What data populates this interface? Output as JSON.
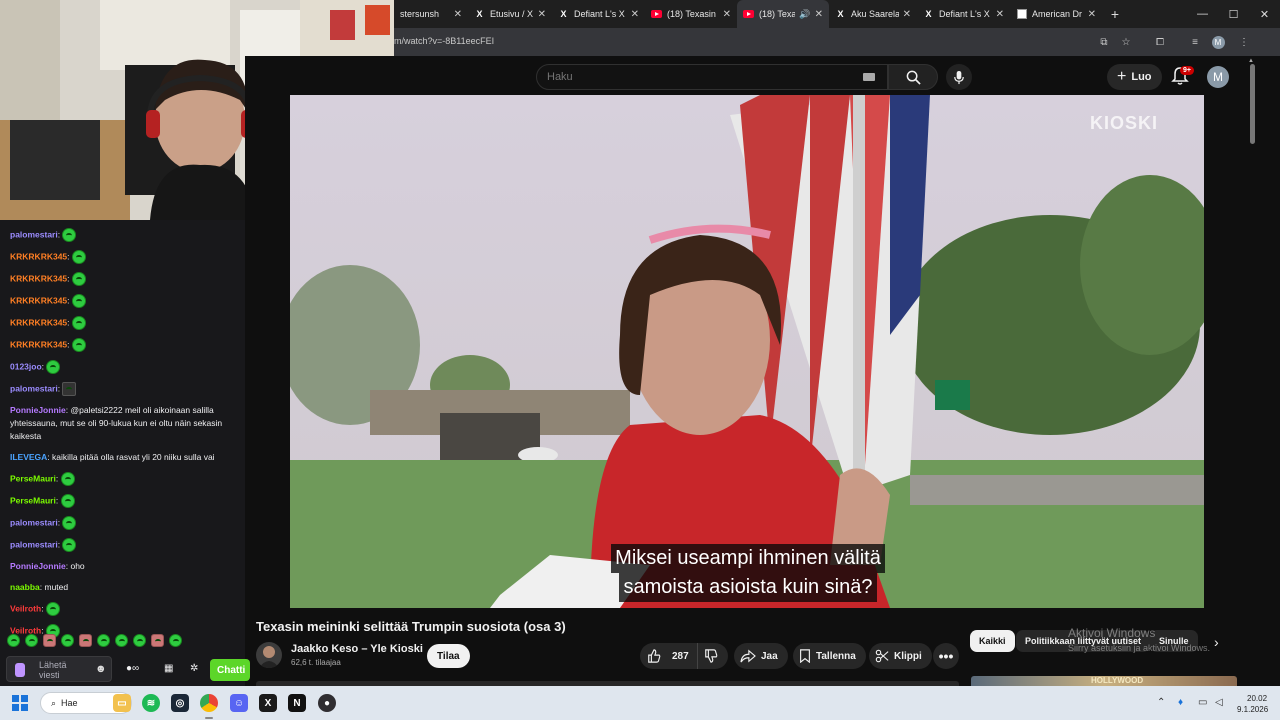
{
  "browser": {
    "tabs": [
      {
        "label": "stersunsh",
        "icon": "none",
        "active": false
      },
      {
        "label": "Etusivu / X",
        "icon": "x",
        "active": false
      },
      {
        "label": "Defiant L's X",
        "icon": "x",
        "active": false
      },
      {
        "label": "(18) Texasin",
        "icon": "youtube",
        "active": false
      },
      {
        "label": "(18) Texa",
        "icon": "youtube",
        "active": true
      },
      {
        "label": "Aku Saarela",
        "icon": "x",
        "active": false
      },
      {
        "label": "Defiant L's X",
        "icon": "x",
        "active": false
      },
      {
        "label": "American Dr",
        "icon": "doc",
        "active": false
      }
    ],
    "new_tab": "+",
    "url": "m/watch?v=-8B11eecFEI",
    "profile_initial": "M"
  },
  "youtube": {
    "search_placeholder": "Haku",
    "create_label": "Luo",
    "notification_badge": "9+",
    "avatar_initial": "M",
    "watermark": "KIOSKI",
    "subtitle_line1": "Miksei useampi ihminen välitä",
    "subtitle_line2": "samoista asioista kuin sinä?",
    "video_title": "Texasin meininki selittää Trumpin suosiota (osa 3)",
    "channel_name": "Jaakko Keso – Yle Kioski",
    "channel_subs": "62,6 t. tilaajaa",
    "subscribe_label": "Tilaa",
    "like_count": "287",
    "share_label": "Jaa",
    "save_label": "Tallenna",
    "clip_label": "Klippi",
    "more_label": "•••",
    "chips": [
      "Kaikki",
      "Politiikkaan liittyvät uutiset",
      "Sinulle"
    ],
    "thumb_text": "HOLLYWOOD"
  },
  "windows_activation": {
    "title": "Aktivoi Windows",
    "subtitle": "Siirry asetuksiin ja aktivoi Windows."
  },
  "chat": {
    "messages": [
      {
        "user": "palomestari",
        "color": "#9b8cff",
        "text": "",
        "emote": "green"
      },
      {
        "user": "KRKRKRK345",
        "color": "#ff7f24",
        "text": "",
        "emote": "green"
      },
      {
        "user": "KRKRKRK345",
        "color": "#ff7f24",
        "text": "",
        "emote": "green"
      },
      {
        "user": "KRKRKRK345",
        "color": "#ff7f24",
        "text": "",
        "emote": "green"
      },
      {
        "user": "KRKRKRK345",
        "color": "#ff7f24",
        "text": "",
        "emote": "green"
      },
      {
        "user": "KRKRKRK345",
        "color": "#ff7f24",
        "text": "",
        "emote": "green"
      },
      {
        "user": "0123joo",
        "color": "#9b8cff",
        "text": "",
        "emote": "green"
      },
      {
        "user": "palomestari",
        "color": "#9b8cff",
        "text": "",
        "emote": "dark"
      },
      {
        "user": "PonnieJonnie",
        "color": "#b57aff",
        "text": "@paletsi2222 meil oli aikoinaan salilla yhteissauna, mut se oli 90-lukua kun ei oltu näin sekasin kaikesta",
        "emote": ""
      },
      {
        "user": "ILEVEGA",
        "color": "#4aa3ff",
        "text": "kaikilla pitää olla rasvat yli 20 niiku sulla vai",
        "emote": ""
      },
      {
        "user": "PerseMauri",
        "color": "#7cfc00",
        "text": "",
        "emote": "green"
      },
      {
        "user": "PerseMauri",
        "color": "#7cfc00",
        "text": "",
        "emote": "green"
      },
      {
        "user": "palomestari",
        "color": "#9b8cff",
        "text": "",
        "emote": "green"
      },
      {
        "user": "palomestari",
        "color": "#9b8cff",
        "text": "",
        "emote": "green"
      },
      {
        "user": "PonnieJonnie",
        "color": "#b57aff",
        "text": "oho",
        "emote": ""
      },
      {
        "user": "naabba",
        "color": "#7cfc00",
        "text": "muted",
        "emote": ""
      },
      {
        "user": "Veilroth",
        "color": "#ff3b3b",
        "text": "",
        "emote": "green"
      },
      {
        "user": "Veilroth",
        "color": "#ff3b3b",
        "text": "",
        "emote": "green"
      }
    ],
    "input_placeholder": "Lähetä viesti",
    "send_label": "Chatti"
  },
  "taskbar": {
    "search_label": "Hae",
    "time": "20.02",
    "date": "9.1.2026"
  },
  "colors": {
    "youtube_red": "#ff0033",
    "chat_send": "#5cd629",
    "taskbar_bg": "#dfe6ee"
  }
}
